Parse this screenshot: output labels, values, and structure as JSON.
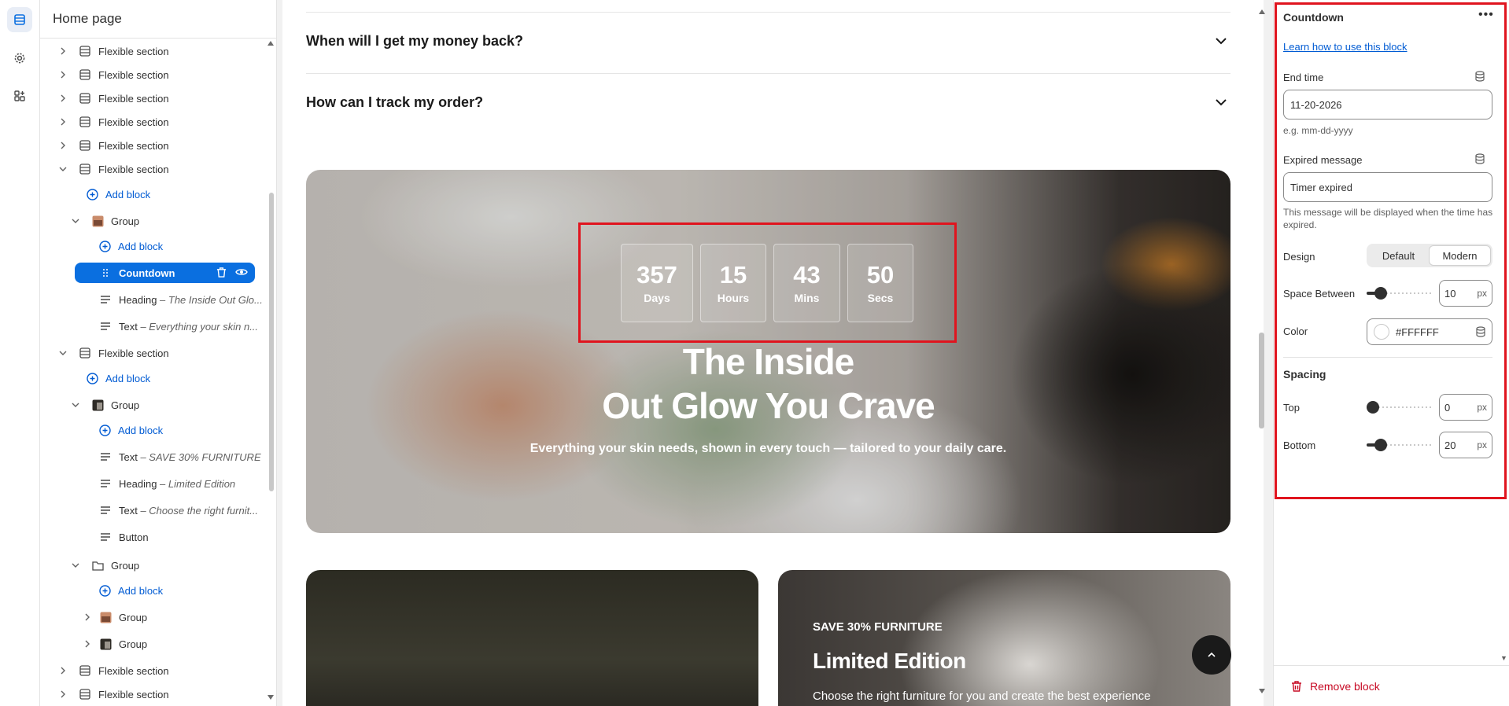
{
  "sidebar": {
    "title": "Home page",
    "rows": [
      {
        "label": "Flexible section",
        "em": ""
      },
      {
        "label": "Flexible section",
        "em": ""
      },
      {
        "label": "Flexible section",
        "em": ""
      },
      {
        "label": "Flexible section",
        "em": ""
      },
      {
        "label": "Flexible section",
        "em": ""
      },
      {
        "label": "Flexible section",
        "em": ""
      },
      {
        "label": "Add block",
        "em": ""
      },
      {
        "label": "Group",
        "em": ""
      },
      {
        "label": "Add block",
        "em": ""
      },
      {
        "label": "Countdown",
        "em": ""
      },
      {
        "label": "Heading",
        "em": " – The Inside Out Glo..."
      },
      {
        "label": "Text",
        "em": " – Everything your skin n..."
      },
      {
        "label": "Flexible section",
        "em": ""
      },
      {
        "label": "Add block",
        "em": ""
      },
      {
        "label": "Group",
        "em": ""
      },
      {
        "label": "Add block",
        "em": ""
      },
      {
        "label": "Text",
        "em": " – SAVE 30% FURNITURE"
      },
      {
        "label": "Heading",
        "em": " – Limited Edition"
      },
      {
        "label": "Text",
        "em": " – Choose the right furnit..."
      },
      {
        "label": "Button",
        "em": ""
      },
      {
        "label": "Group",
        "em": ""
      },
      {
        "label": "Add block",
        "em": ""
      },
      {
        "label": "Group",
        "em": ""
      },
      {
        "label": "Group",
        "em": ""
      },
      {
        "label": "Flexible section",
        "em": ""
      },
      {
        "label": "Flexible section",
        "em": ""
      }
    ]
  },
  "preview": {
    "faq": [
      {
        "question": "When will I get my money back?"
      },
      {
        "question": "How can I track my order?"
      }
    ],
    "countdown": [
      {
        "value": "357",
        "unit": "Days"
      },
      {
        "value": "15",
        "unit": "Hours"
      },
      {
        "value": "43",
        "unit": "Mins"
      },
      {
        "value": "50",
        "unit": "Secs"
      }
    ],
    "hero_heading_line1": "The Inside",
    "hero_heading_line2": "Out Glow You Crave",
    "hero_subtext": "Everything your skin needs, shown in every touch — tailored to your daily care.",
    "card_eyebrow": "SAVE 30% FURNITURE",
    "card_title": "Limited Edition",
    "card_body": "Choose the right furniture for you and create the best experience",
    "scroll_top_icon": "chevron-up-icon"
  },
  "panel": {
    "title": "Countdown",
    "more_label": "•••",
    "help_link": "Learn how to use this block",
    "end_time_label": "End time",
    "end_time_value": "11-20-2026",
    "end_time_help": "e.g. mm-dd-yyyy",
    "expired_label": "Expired message",
    "expired_value": "Timer expired",
    "expired_help": "This message will be displayed when the time has expired.",
    "design_label": "Design",
    "design_options": [
      "Default",
      "Modern"
    ],
    "design_selected": "Modern",
    "space_between_label": "Space Between",
    "space_between_value": "10",
    "unit_px": "px",
    "color_label": "Color",
    "color_value": "#FFFFFF",
    "spacing_heading": "Spacing",
    "top_label": "Top",
    "top_value": "0",
    "bottom_label": "Bottom",
    "bottom_value": "20",
    "remove_label": "Remove block"
  },
  "colors": {
    "accent": "#0a6fe0",
    "link": "#005bd3",
    "danger": "#c70a24",
    "highlight": "#e0141e"
  }
}
